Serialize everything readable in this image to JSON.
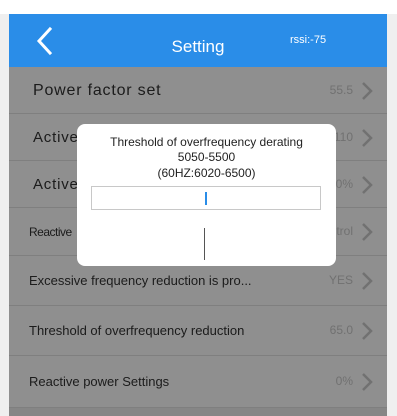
{
  "header": {
    "title": "Setting",
    "rssi": "rssi:-75"
  },
  "settings": [
    {
      "label": "Power factor set",
      "value": "55.5"
    },
    {
      "label": "Active",
      "value": "110"
    },
    {
      "label": "Active",
      "value": "0%"
    },
    {
      "label": "Reactive",
      "value": "ntrol"
    },
    {
      "label": "Excessive frequency reduction is pro...",
      "value": "YES"
    },
    {
      "label": "Threshold of overfrequency reduction",
      "value": "65.0"
    },
    {
      "label": "Reactive power Settings",
      "value": "0%"
    }
  ],
  "dialog": {
    "title": "Threshold of overfrequency derating",
    "range": "5050-5500",
    "range_60hz": "(60HZ:6020-6500)",
    "input_value": ""
  },
  "colors": {
    "header_bg": "#2a8de8",
    "overlay": "rgba(0,0,0,0.44)"
  },
  "icons": {
    "back": "back-arrow-icon",
    "row": "chevron-right-icon"
  }
}
